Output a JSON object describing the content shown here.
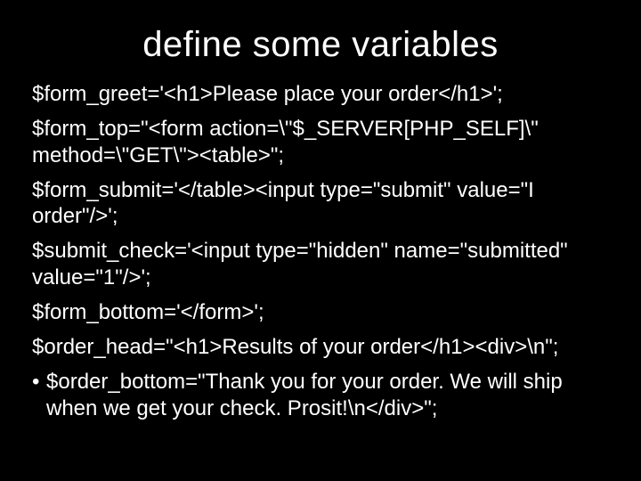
{
  "slide": {
    "title": "define some variables",
    "lines": [
      "$form_greet='<h1>Please place your order</h1>';",
      "$form_top=\"<form action=\\\"$_SERVER[PHP_SELF]\\\" method=\\\"GET\\\"><table>\";",
      "$form_submit='</table><input type=\"submit\" value=\"I order\"/>';",
      "$submit_check='<input type=\"hidden\" name=\"submitted\" value=\"1\"/>';",
      "$form_bottom='</form>';",
      "$order_head=\"<h1>Results of your order</h1><div>\\n\";"
    ],
    "bullet_line": "$order_bottom=\"Thank you for your order. We will ship when we get your check. Prosit!\\n</div>\";"
  }
}
